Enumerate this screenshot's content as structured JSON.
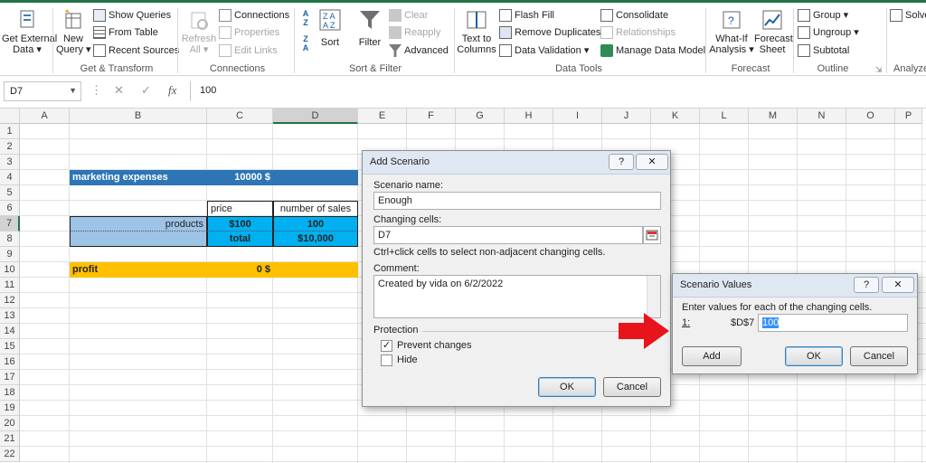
{
  "ribbon": {
    "get_external_data": {
      "line1": "Get External",
      "line2": "Data ▾"
    },
    "new_query": {
      "line1": "New",
      "line2": "Query ▾"
    },
    "show_queries": "Show Queries",
    "from_table": "From Table",
    "recent_sources": "Recent Sources",
    "group_get_transform": "Get & Transform",
    "refresh_all": {
      "line1": "Refresh",
      "line2": "All ▾"
    },
    "connections": "Connections",
    "properties": "Properties",
    "edit_links": "Edit Links",
    "group_connections": "Connections",
    "sort": "Sort",
    "filter": "Filter",
    "clear": "Clear",
    "reapply": "Reapply",
    "advanced": "Advanced",
    "group_sort_filter": "Sort & Filter",
    "text_to_columns": {
      "line1": "Text to",
      "line2": "Columns"
    },
    "flash_fill": "Flash Fill",
    "remove_duplicates": "Remove Duplicates",
    "data_validation": "Data Validation  ▾",
    "consolidate": "Consolidate",
    "relationships": "Relationships",
    "manage_data_model": "Manage Data Model",
    "group_data_tools": "Data Tools",
    "what_if": {
      "line1": "What-If",
      "line2": "Analysis ▾"
    },
    "forecast_sheet": {
      "line1": "Forecast",
      "line2": "Sheet"
    },
    "group_forecast": "Forecast",
    "group": "Group  ▾",
    "ungroup": "Ungroup  ▾",
    "subtotal": "Subtotal",
    "group_outline": "Outline",
    "solver": "Solve",
    "group_analyze": "Analyze",
    "accent": "#217346"
  },
  "formula_bar": {
    "name_box": "D7",
    "fx": "fx",
    "value": "100"
  },
  "columns": [
    "A",
    "B",
    "C",
    "D",
    "E",
    "F",
    "G",
    "H",
    "I",
    "J",
    "K",
    "L",
    "M",
    "N",
    "O",
    "P"
  ],
  "rows": [
    "1",
    "2",
    "3",
    "4",
    "5",
    "6",
    "7",
    "8",
    "9",
    "10",
    "11",
    "12",
    "13",
    "14",
    "15",
    "16",
    "17",
    "18",
    "19",
    "20",
    "21",
    "22"
  ],
  "cells": {
    "b4": "marketing expenses",
    "c4": "10000 $",
    "c6": "price",
    "d6": "number of sales",
    "b7": "products",
    "c7": "$100",
    "d7": "100",
    "c8": "total",
    "d8": "$10,000",
    "b10": "profit",
    "c10": "0 $"
  },
  "colors": {
    "marketing_fill": "#2e75b6",
    "table_fill": "#9dc3e6",
    "selected_fill": "#00b0f0",
    "profit_fill": "#ffc000"
  },
  "add_scenario": {
    "title": "Add Scenario",
    "help": "?",
    "close": "✕",
    "name_label": "Scenario name:",
    "name_value": "Enough",
    "changing_label": "Changing cells:",
    "changing_value": "D7",
    "hint": "Ctrl+click cells to select non-adjacent changing cells.",
    "comment_label": "Comment:",
    "comment_value": "Created by vida on 6/2/2022",
    "protection_label": "Protection",
    "prevent_changes": "Prevent changes",
    "hide": "Hide",
    "ok": "OK",
    "cancel": "Cancel"
  },
  "scenario_values": {
    "title": "Scenario Values",
    "help": "?",
    "close": "✕",
    "prompt": "Enter values for each of the changing cells.",
    "row_index": "1:",
    "cell_ref": "$D$7",
    "value": "100",
    "add": "Add",
    "ok": "OK",
    "cancel": "Cancel"
  },
  "arrow_color": "#e8141c"
}
